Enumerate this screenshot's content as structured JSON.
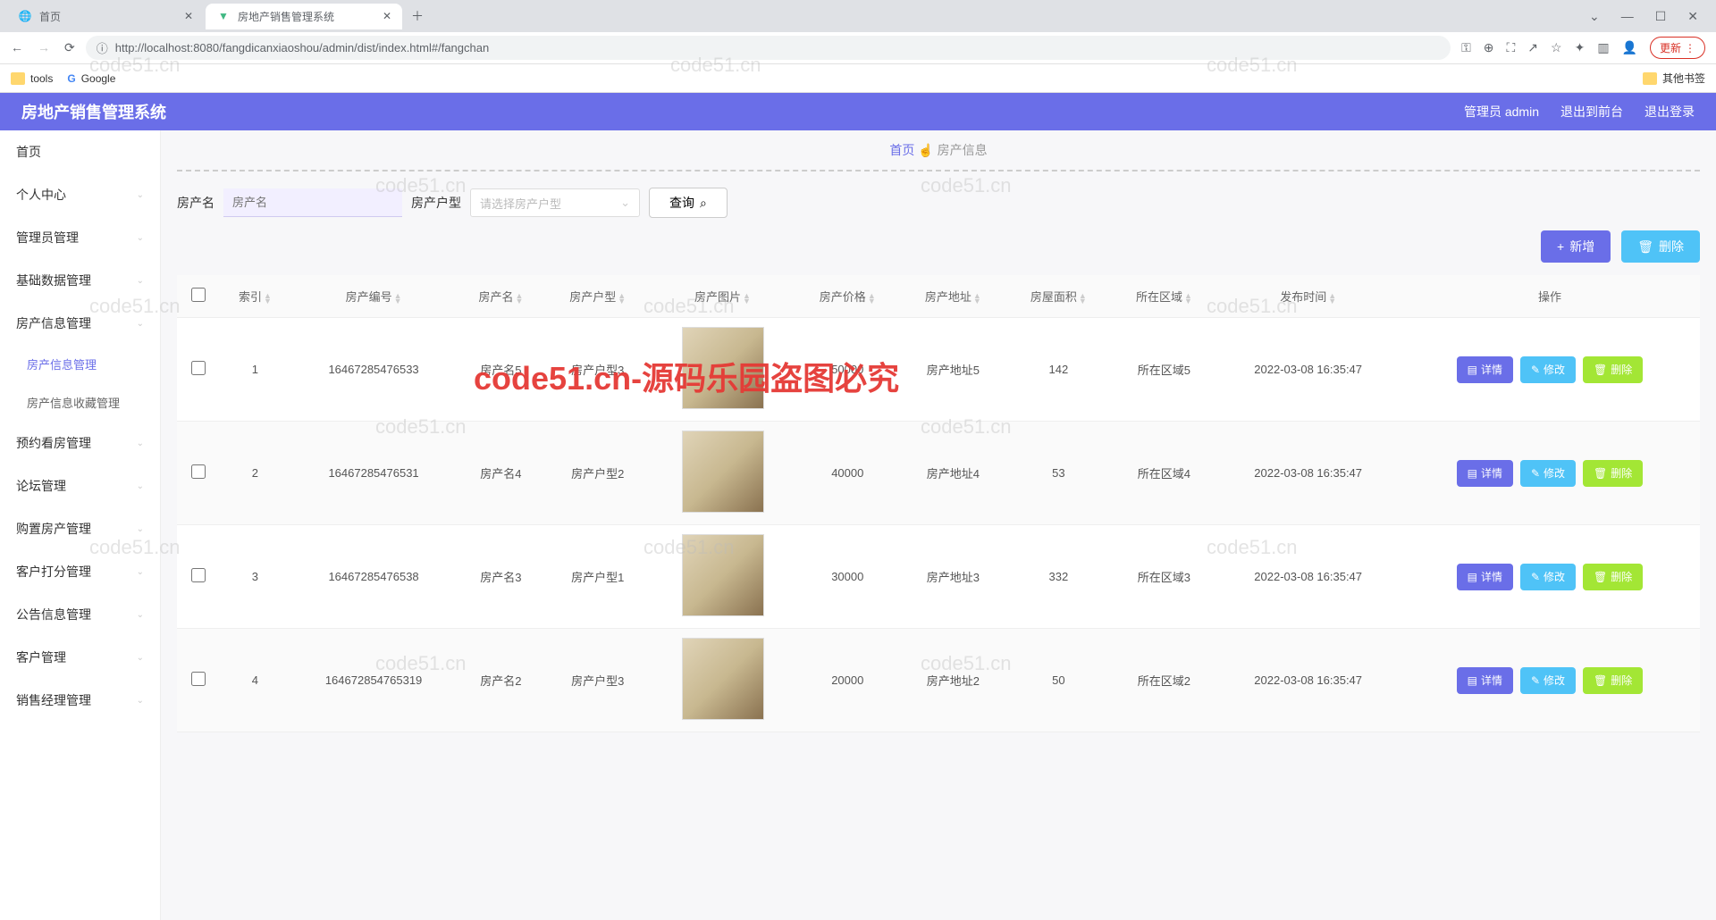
{
  "browser": {
    "tabs": [
      {
        "title": "首页",
        "active": false
      },
      {
        "title": "房地产销售管理系统",
        "active": true
      }
    ],
    "url": "http://localhost:8080/fangdicanxiaoshou/admin/dist/index.html#/fangchan",
    "update_btn": "更新",
    "bookmarks": {
      "tools": "tools",
      "google": "Google",
      "other": "其他书签"
    }
  },
  "header": {
    "title": "房地产销售管理系统",
    "user_label": "管理员 admin",
    "to_front": "退出到前台",
    "logout": "退出登录"
  },
  "sidebar": {
    "items": [
      {
        "label": "首页",
        "expandable": false
      },
      {
        "label": "个人中心",
        "expandable": true
      },
      {
        "label": "管理员管理",
        "expandable": true
      },
      {
        "label": "基础数据管理",
        "expandable": true
      },
      {
        "label": "房产信息管理",
        "expandable": true,
        "open": true,
        "children": [
          {
            "label": "房产信息管理",
            "active": true
          },
          {
            "label": "房产信息收藏管理",
            "active": false
          }
        ]
      },
      {
        "label": "预约看房管理",
        "expandable": true
      },
      {
        "label": "论坛管理",
        "expandable": true
      },
      {
        "label": "购置房产管理",
        "expandable": true
      },
      {
        "label": "客户打分管理",
        "expandable": true
      },
      {
        "label": "公告信息管理",
        "expandable": true
      },
      {
        "label": "客户管理",
        "expandable": true
      },
      {
        "label": "销售经理管理",
        "expandable": true
      }
    ]
  },
  "breadcrumb": {
    "home": "首页",
    "current": "房产信息"
  },
  "search": {
    "name_label": "房产名",
    "name_placeholder": "房产名",
    "type_label": "房产户型",
    "type_placeholder": "请选择房产户型",
    "query_btn": "查询"
  },
  "actions": {
    "add": "新增",
    "delete": "删除"
  },
  "table": {
    "headers": [
      "",
      "索引",
      "房产编号",
      "房产名",
      "房产户型",
      "房产图片",
      "房产价格",
      "房产地址",
      "房屋面积",
      "所在区域",
      "发布时间",
      "操作"
    ],
    "row_buttons": {
      "detail": "详情",
      "edit": "修改",
      "delete": "删除"
    },
    "rows": [
      {
        "idx": "1",
        "code": "16467285476533",
        "name": "房产名5",
        "type": "房产户型3",
        "price": "50000",
        "addr": "房产地址5",
        "area": "142",
        "region": "所在区域5",
        "time": "2022-03-08 16:35:47"
      },
      {
        "idx": "2",
        "code": "16467285476531",
        "name": "房产名4",
        "type": "房产户型2",
        "price": "40000",
        "addr": "房产地址4",
        "area": "53",
        "region": "所在区域4",
        "time": "2022-03-08 16:35:47"
      },
      {
        "idx": "3",
        "code": "16467285476538",
        "name": "房产名3",
        "type": "房产户型1",
        "price": "30000",
        "addr": "房产地址3",
        "area": "332",
        "region": "所在区域3",
        "time": "2022-03-08 16:35:47"
      },
      {
        "idx": "4",
        "code": "164672854765319",
        "name": "房产名2",
        "type": "房产户型3",
        "price": "20000",
        "addr": "房产地址2",
        "area": "50",
        "region": "所在区域2",
        "time": "2022-03-08 16:35:47"
      }
    ]
  },
  "watermark": {
    "text": "code51.cn",
    "red": "code51.cn-源码乐园盗图必究"
  }
}
